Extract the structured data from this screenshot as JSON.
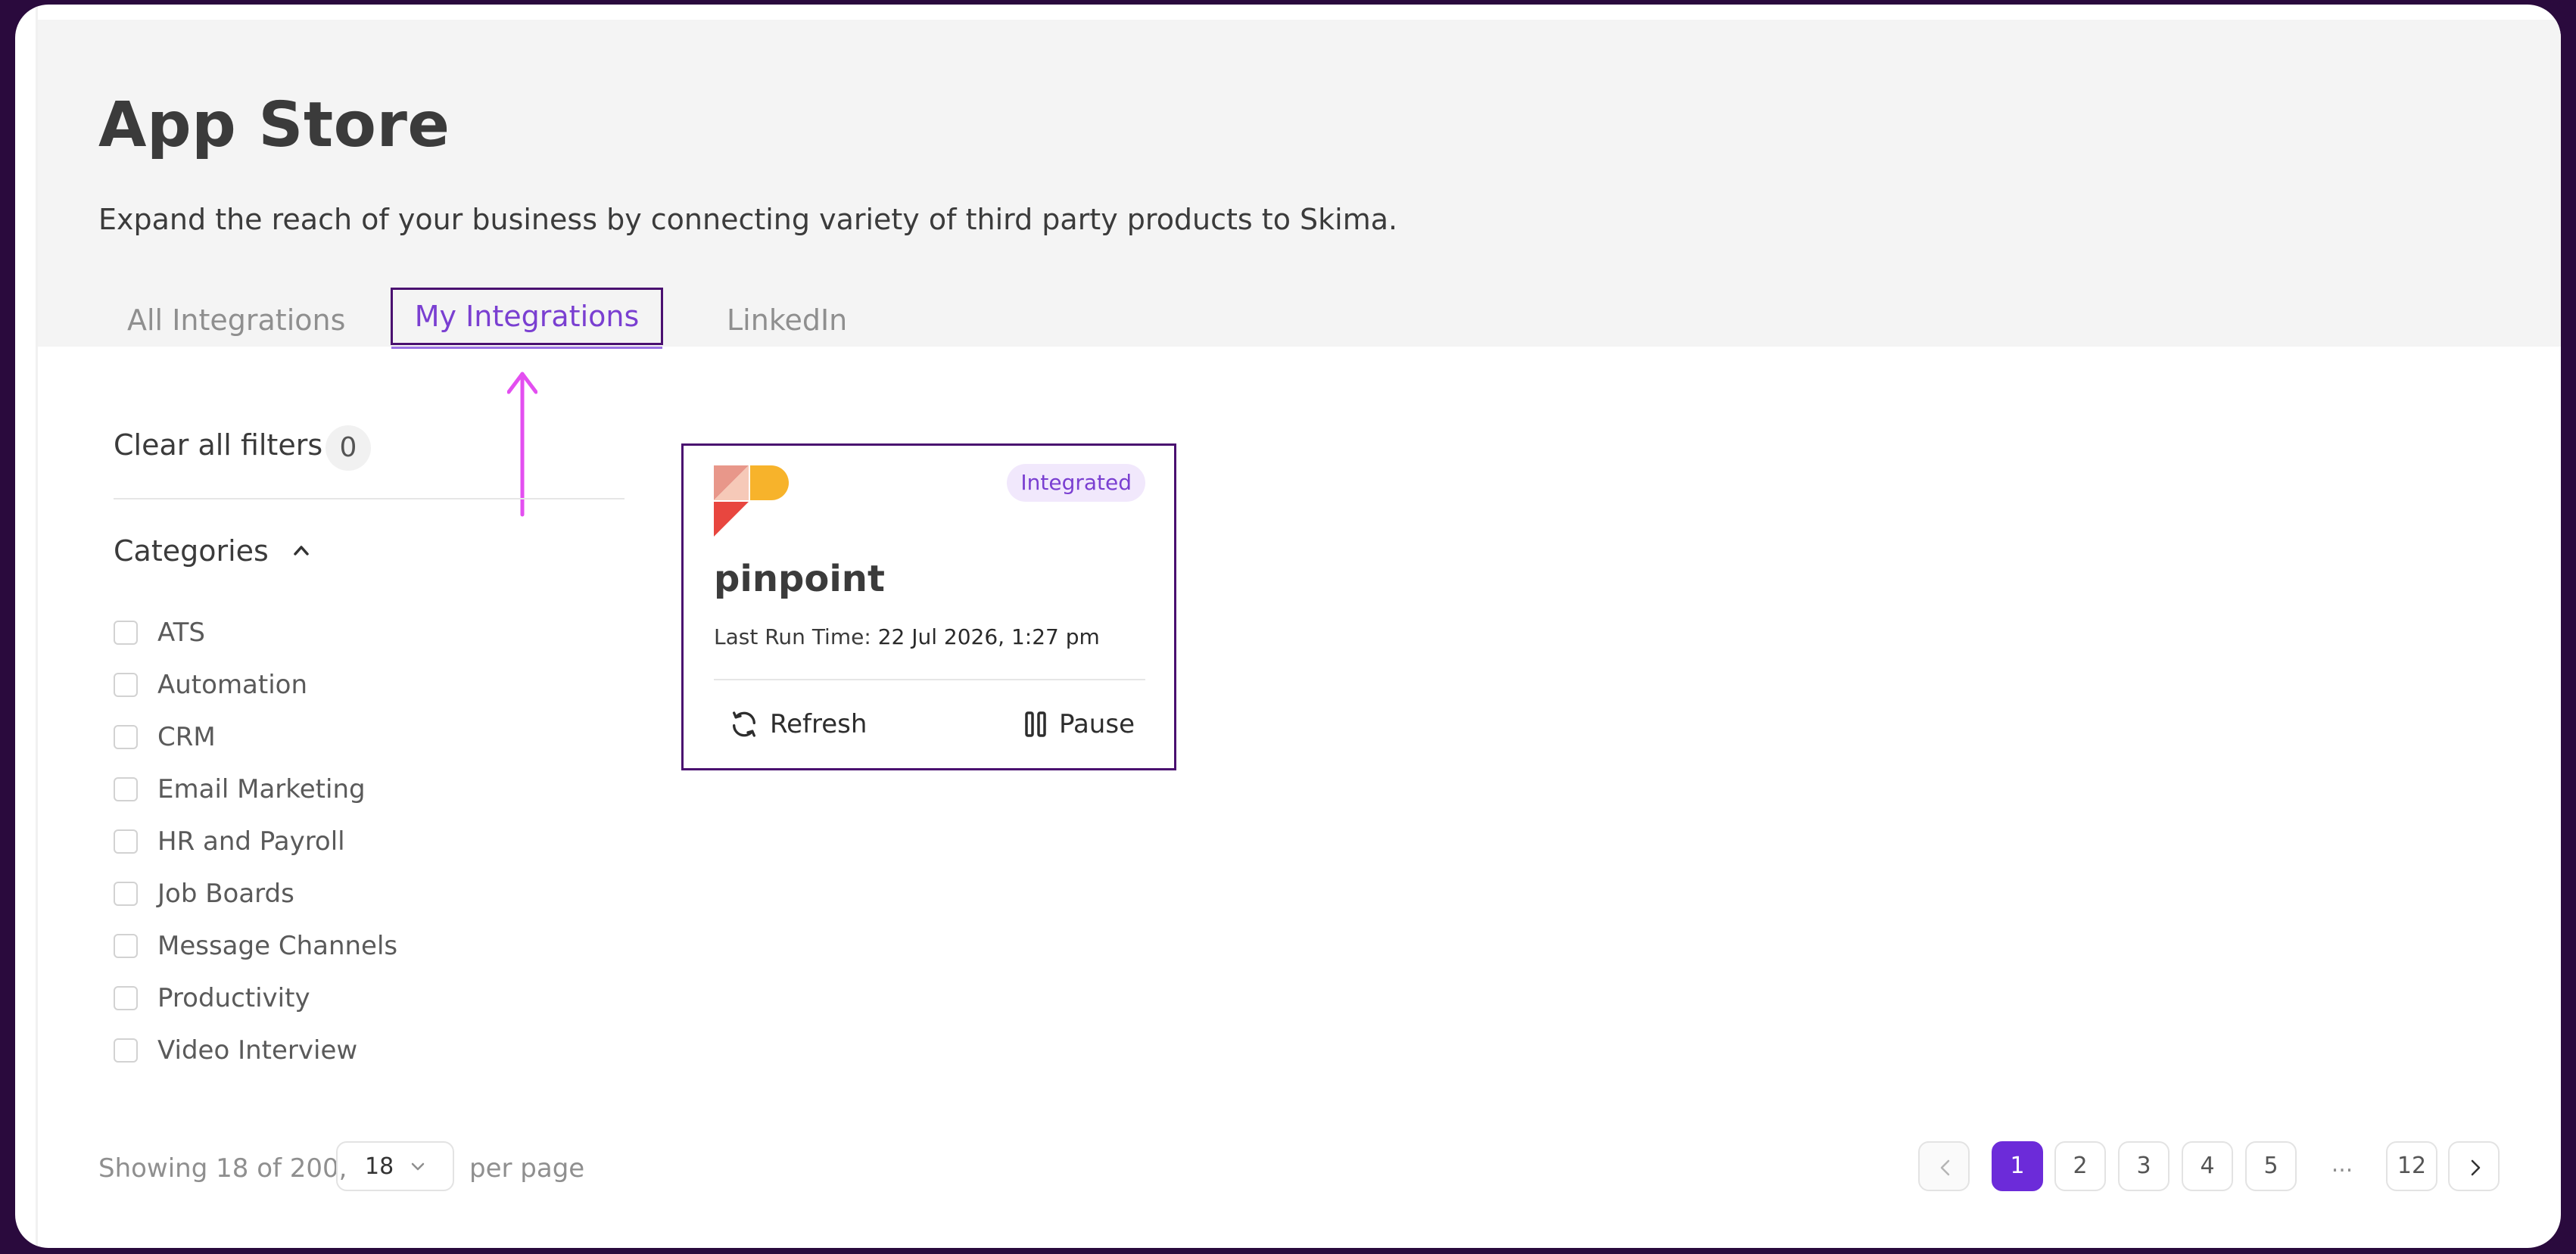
{
  "header": {
    "title": "App Store",
    "subtitle": "Expand the reach of your business by connecting variety of third party products to Skima."
  },
  "tabs": [
    {
      "label": "All Integrations",
      "active": false
    },
    {
      "label": "My Integrations",
      "active": true
    },
    {
      "label": "LinkedIn",
      "active": false
    }
  ],
  "filters": {
    "clear_label": "Clear all filters",
    "count": "0",
    "categories_title": "Categories",
    "categories": [
      "ATS",
      "Automation",
      "CRM",
      "Email Marketing",
      "HR and Payroll",
      "Job Boards",
      "Message Channels",
      "Productivity",
      "Video Interview"
    ]
  },
  "card": {
    "title": "pinpoint",
    "badge": "Integrated",
    "run_time_label": "Last Run Time:",
    "run_time_value": "22 Jul 2026, 1:27 pm",
    "refresh_label": "Refresh",
    "pause_label": "Pause"
  },
  "pagination": {
    "showing": "Showing 18 of 200,",
    "per_page_value": "18",
    "per_page_label": "per page",
    "pages": [
      "1",
      "2",
      "3",
      "4",
      "5"
    ],
    "ellipsis": "...",
    "last_page": "12",
    "current_page": "1"
  },
  "colors": {
    "accent": "#6c2bd9",
    "annotation": "#e34ff0",
    "highlight_border": "#4a1070"
  }
}
